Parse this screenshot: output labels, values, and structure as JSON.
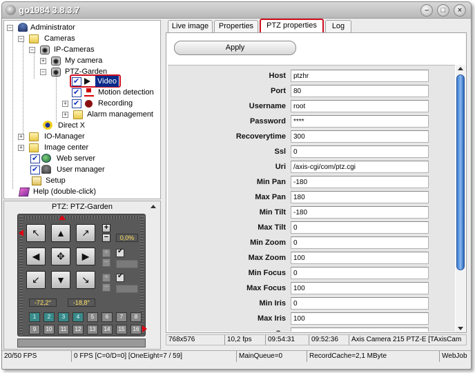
{
  "window": {
    "title": "go1984 3.8.3.7"
  },
  "tree": {
    "administrator": "Administrator",
    "cameras": "Cameras",
    "ip_cameras": "IP-Cameras",
    "my_camera": "My camera",
    "ptz_garden": "PTZ-Garden",
    "video": "Video",
    "motion_detection": "Motion detection",
    "recording": "Recording",
    "alarm_management": "Alarm management",
    "direct_x": "Direct X",
    "io_manager": "IO-Manager",
    "image_center": "Image center",
    "web_server": "Web server",
    "user_manager": "User manager",
    "setup": "Setup",
    "help": "Help (double-click)"
  },
  "ptz": {
    "title": "PTZ: PTZ-Garden",
    "zoom_value": "0,0%",
    "pan_value": "-72,2°",
    "tilt_value": "-18,8°",
    "presets": [
      "1",
      "2",
      "3",
      "4",
      "5",
      "6",
      "7",
      "8",
      "9",
      "10",
      "11",
      "12",
      "13",
      "14",
      "15",
      "16"
    ]
  },
  "tabs": {
    "live_image": "Live image",
    "properties": "Properties",
    "ptz_properties": "PTZ properties",
    "log": "Log"
  },
  "apply_label": "Apply",
  "properties": [
    {
      "label": "Host",
      "value": "ptzhr"
    },
    {
      "label": "Port",
      "value": "80"
    },
    {
      "label": "Username",
      "value": "root"
    },
    {
      "label": "Password",
      "value": "****"
    },
    {
      "label": "Recoverytime",
      "value": "300"
    },
    {
      "label": "Ssl",
      "value": "0"
    },
    {
      "label": "Uri",
      "value": "/axis-cgi/com/ptz.cgi"
    },
    {
      "label": "Min Pan",
      "value": "-180"
    },
    {
      "label": "Max Pan",
      "value": "180"
    },
    {
      "label": "Min Tilt",
      "value": "-180"
    },
    {
      "label": "Max Tilt",
      "value": "0"
    },
    {
      "label": "Min Zoom",
      "value": "0"
    },
    {
      "label": "Max Zoom",
      "value": "100"
    },
    {
      "label": "Min Focus",
      "value": "0"
    },
    {
      "label": "Max Focus",
      "value": "100"
    },
    {
      "label": "Min Iris",
      "value": "0"
    },
    {
      "label": "Max Iris",
      "value": "100"
    },
    {
      "label": "Go",
      "value": ""
    }
  ],
  "info": {
    "resolution": "768x576",
    "fps": "10,2 fps",
    "time1": "09:54:31",
    "time2": "09:52:36",
    "camera": "Axis Camera 215 PTZ-E [TAxisCam"
  },
  "status": {
    "fps": "20/50 FPS",
    "counters": "0 FPS [C=0/D=0] [OneEight=7 / 59]",
    "main_queue": "MainQueue=0",
    "record_cache": "RecordCache=2,1 MByte",
    "webjob": "WebJob"
  },
  "colors": {
    "highlight": "#d01020",
    "selection": "#0a2a8a",
    "scroll_thumb": "#3a7ad0"
  }
}
